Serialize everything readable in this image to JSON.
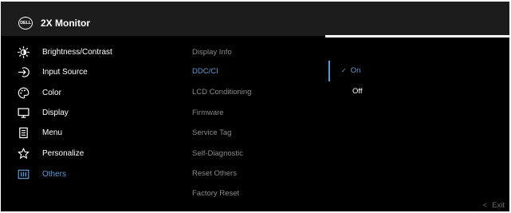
{
  "header": {
    "logo_text": "DELL",
    "title": "2X Monitor"
  },
  "main_menu": {
    "items": [
      {
        "label": "Brightness/Contrast",
        "icon": "brightness-icon"
      },
      {
        "label": "Input Source",
        "icon": "input-source-icon"
      },
      {
        "label": "Color",
        "icon": "color-palette-icon"
      },
      {
        "label": "Display",
        "icon": "display-monitor-icon"
      },
      {
        "label": "Menu",
        "icon": "menu-list-icon"
      },
      {
        "label": "Personalize",
        "icon": "star-icon"
      },
      {
        "label": "Others",
        "icon": "others-icon",
        "active": true
      }
    ]
  },
  "submenu": {
    "items": [
      {
        "label": "Display Info"
      },
      {
        "label": "DDC/CI",
        "selected": true
      },
      {
        "label": "LCD Conditioning"
      },
      {
        "label": "Firmware"
      },
      {
        "label": "Service Tag"
      },
      {
        "label": "Self-Diagnostic"
      },
      {
        "label": "Reset Others"
      },
      {
        "label": "Factory Reset"
      }
    ]
  },
  "options": {
    "check_mark": "✓",
    "on_label": "On",
    "off_label": "Off",
    "selected": "On"
  },
  "footer": {
    "exit_arrow": "<",
    "exit_label": "Exit"
  },
  "colors": {
    "background": "#000000",
    "header_background": "#1c1c1c",
    "accent": "#5b9bd5",
    "text": "#ffffff",
    "dim_text": "#8a8a8a"
  }
}
